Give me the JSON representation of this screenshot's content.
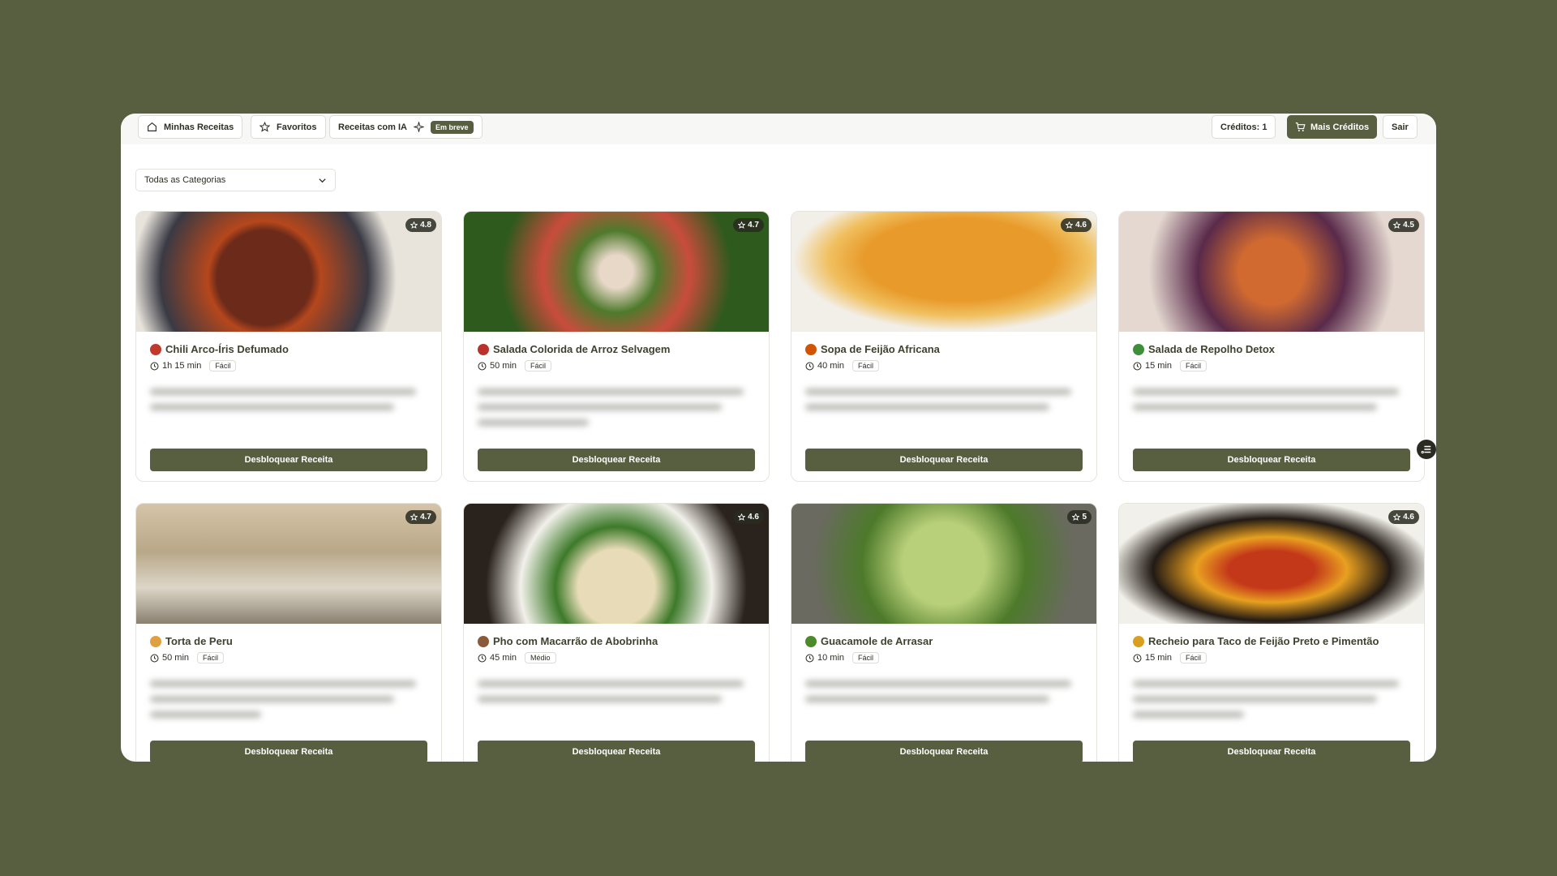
{
  "nav": {
    "my_recipes": "Minhas Receitas",
    "favorites": "Favoritos",
    "ai_recipes": "Receitas com IA",
    "soon_badge": "Em breve"
  },
  "account": {
    "credits": "Créditos: 1",
    "more_credits": "Mais Créditos",
    "logout": "Sair"
  },
  "filter": {
    "category_selected": "Todas as Categorias"
  },
  "unlock_label": "Desbloquear Receita",
  "recipes": [
    {
      "title": "Chili Arco-Íris Defumado",
      "time": "1h 15 min",
      "difficulty": "Fácil",
      "rating": "4.8",
      "icon_color": "#c0392b"
    },
    {
      "title": "Salada Colorida de Arroz Selvagem",
      "time": "50 min",
      "difficulty": "Fácil",
      "rating": "4.7",
      "icon_color": "#b9322b"
    },
    {
      "title": "Sopa de Feijão Africana",
      "time": "40 min",
      "difficulty": "Fácil",
      "rating": "4.6",
      "icon_color": "#d35400"
    },
    {
      "title": "Salada de Repolho Detox",
      "time": "15 min",
      "difficulty": "Fácil",
      "rating": "4.5",
      "icon_color": "#3f8f3a"
    },
    {
      "title": "Torta de Peru",
      "time": "50 min",
      "difficulty": "Fácil",
      "rating": "4.7",
      "icon_color": "#e0a040"
    },
    {
      "title": "Pho com Macarrão de Abobrinha",
      "time": "45 min",
      "difficulty": "Médio",
      "rating": "4.6",
      "icon_color": "#8a5a3a"
    },
    {
      "title": "Guacamole de Arrasar",
      "time": "10 min",
      "difficulty": "Fácil",
      "rating": "5",
      "icon_color": "#4d8a2a"
    },
    {
      "title": "Recheio para Taco de Feijão Preto e Pimentão",
      "time": "15 min",
      "difficulty": "Fácil",
      "rating": "4.6",
      "icon_color": "#d9a020"
    }
  ]
}
